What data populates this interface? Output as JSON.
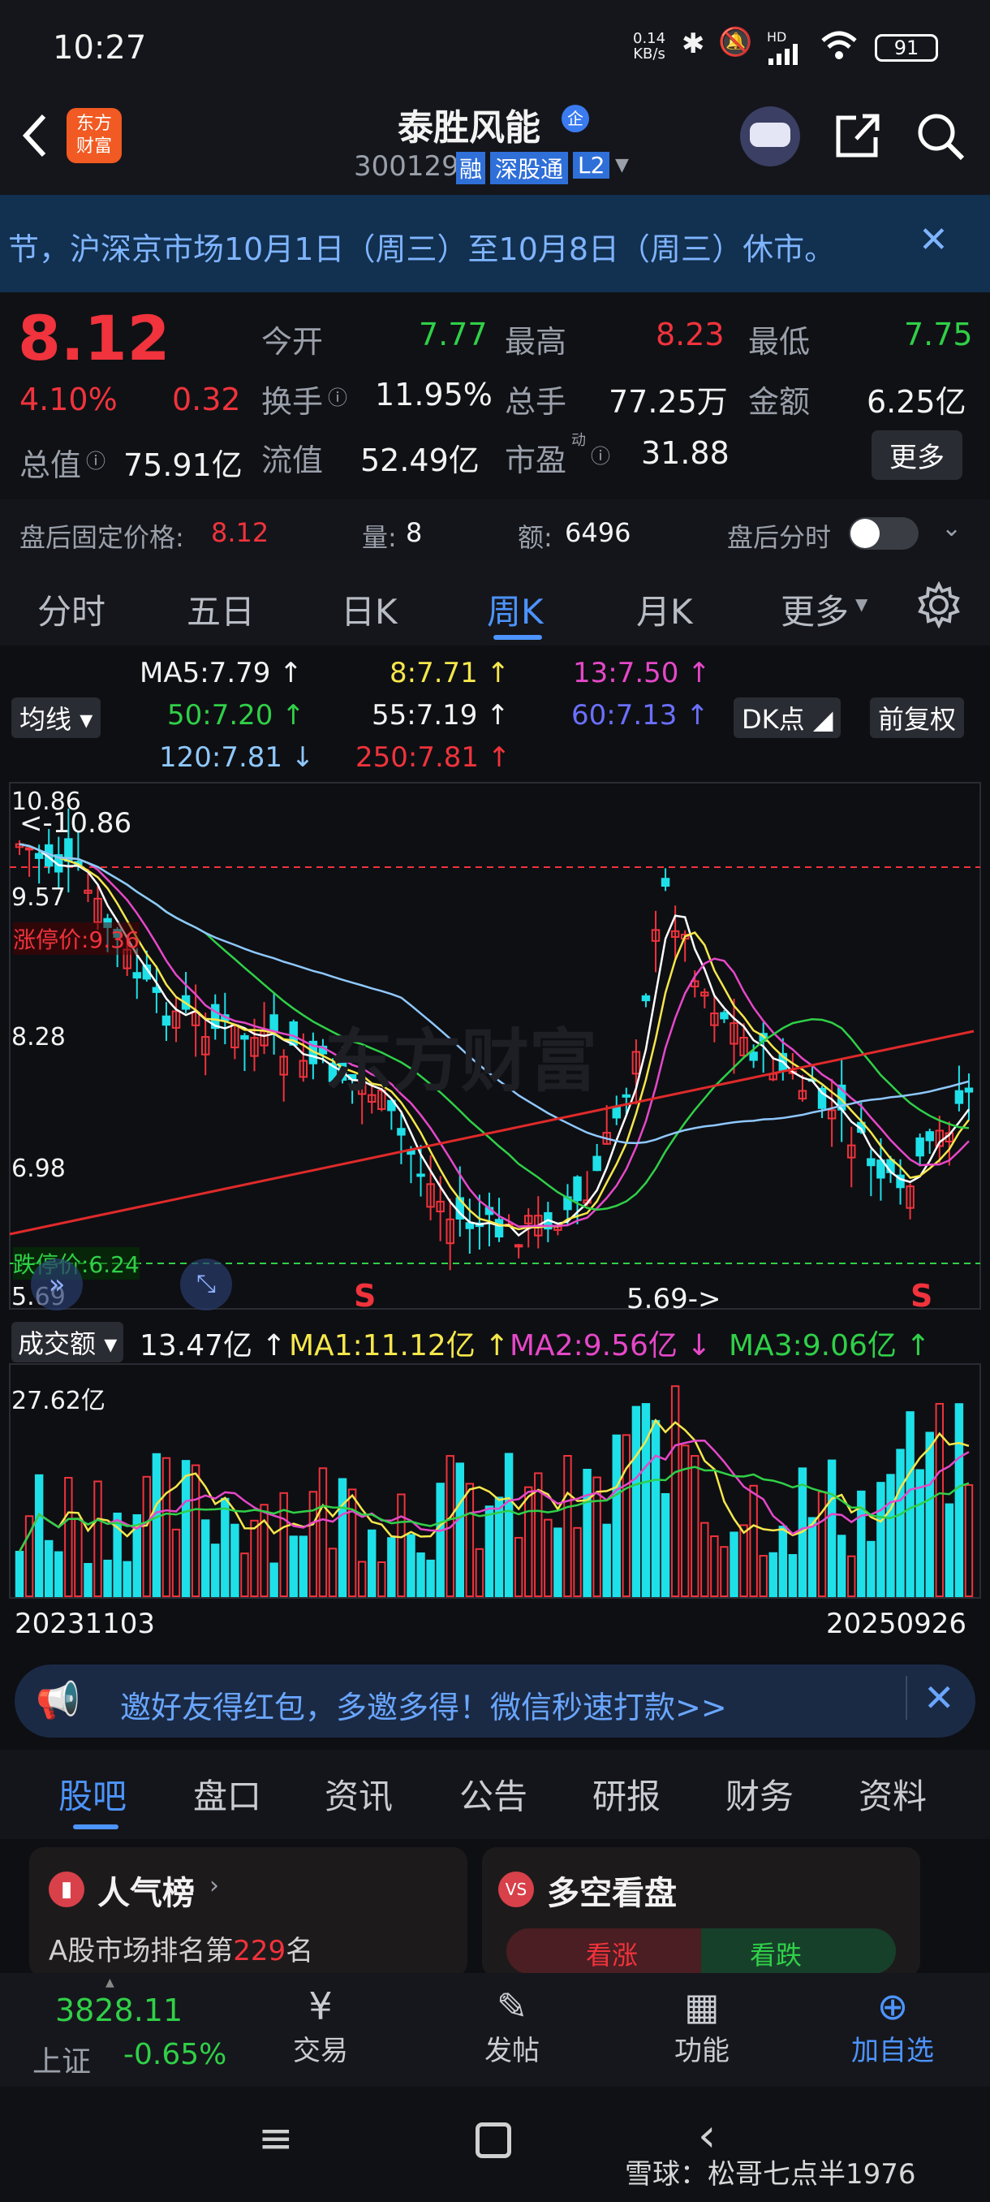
{
  "status_bar": {
    "time": "10:27",
    "net_speed_top": "0.14",
    "net_speed_bottom": "KB/s",
    "hd_label": "HD",
    "battery": "91"
  },
  "header": {
    "logo_line1": "东方",
    "logo_line2": "财富",
    "stock_name": "泰胜风能",
    "stock_badge": "企",
    "stock_code": "300129",
    "tag_margin": "融",
    "tag_connect": "深股通",
    "tag_level": "L2"
  },
  "notice": {
    "text": "节，沪深京市场10月1日（周三）至10月8日（周三）休市。"
  },
  "quote": {
    "price": "8.12",
    "change_pct": "4.10%",
    "change_amt": "0.32",
    "open_label": "今开",
    "open": "7.77",
    "high_label": "最高",
    "high": "8.23",
    "low_label": "最低",
    "low": "7.75",
    "turnover_label": "换手",
    "turnover": "11.95%",
    "volume_label": "总手",
    "volume": "77.25万",
    "amount_label": "金额",
    "amount": "6.25亿",
    "mktcap_label": "总值",
    "mktcap": "75.91亿",
    "float_label": "流值",
    "float": "52.49亿",
    "pe_label": "市盈",
    "pe_sup": "动",
    "pe": "31.88",
    "more": "更多"
  },
  "afterhours": {
    "price_label": "盘后固定价格:",
    "price": "8.12",
    "vol_label": "量:",
    "vol": "8",
    "amt_label": "额:",
    "amt": "6496",
    "toggle_label": "盘后分时"
  },
  "tabs": [
    "分时",
    "五日",
    "日K",
    "周K",
    "月K",
    "更多"
  ],
  "indicators": {
    "ma_select": "均线",
    "ma5": "MA5:7.79 ↑",
    "ma8": "8:7.71 ↑",
    "ma13": "13:7.50 ↑",
    "ma50": "50:7.20 ↑",
    "ma55": "55:7.19 ↑",
    "ma60": "60:7.13 ↑",
    "ma120": "120:7.81 ↓",
    "ma250": "250:7.81 ↑",
    "dk": "DK点",
    "adjust": "前复权"
  },
  "chart_data": {
    "type": "candlestick",
    "price_axis": {
      "ticks": [
        "10.86",
        "9.57",
        "8.28",
        "6.98",
        "5.69"
      ]
    },
    "labels": {
      "high_marker": "<-10.86",
      "low_marker": "5.69->",
      "limit_up": "涨停价:9.36",
      "limit_down": "跌停价:6.24",
      "sell_marker": "S"
    },
    "watermark": "东方财富",
    "volume": {
      "select": "成交额",
      "value": "13.47亿 ↑",
      "ma1": "MA1:11.12亿 ↑",
      "ma2": "MA2:9.56亿 ↓",
      "ma3": "MA3:9.06亿 ↑",
      "max": "27.62亿"
    },
    "x_start": "20231103",
    "x_end": "20250926"
  },
  "banner": {
    "text": "邀好友得红包，多邀多得！微信秒速打款>>"
  },
  "bottom_tabs": [
    "股吧",
    "盘口",
    "资讯",
    "公告",
    "研报",
    "财务",
    "资料"
  ],
  "cards": {
    "left_title": "人气榜",
    "left_sub_prefix": "A股市场排名第",
    "left_rank": "229",
    "left_sub_suffix": "名",
    "right_title": "多空看盘",
    "up": "看涨",
    "down": "看跌"
  },
  "nav": {
    "index_value": "3828.11",
    "index_name": "上证",
    "index_change": "-0.65%",
    "trade": "交易",
    "post": "发帖",
    "func": "功能",
    "add": "加自选"
  },
  "footer": {
    "watermark": "雪球：松哥七点半1976"
  },
  "colors": {
    "up": "#f0333c",
    "down": "#1ee0e8",
    "accent": "#3a8bff"
  }
}
